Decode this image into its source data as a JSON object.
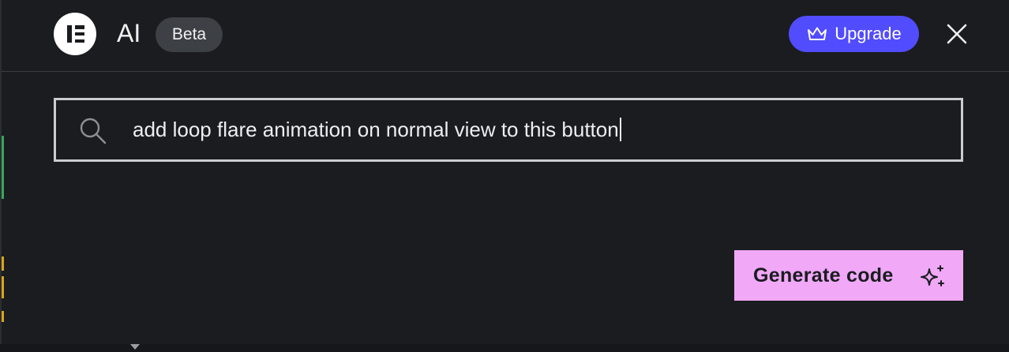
{
  "header": {
    "title": "AI",
    "badge": "Beta",
    "upgrade_label": "Upgrade",
    "logo_icon": "elementor-logo-icon",
    "upgrade_icon": "crown-icon",
    "close_icon": "close-icon"
  },
  "prompt": {
    "value": "add loop flare animation on normal view to this button",
    "icon": "search-icon"
  },
  "actions": {
    "generate_label": "Generate code",
    "generate_icon": "sparkle-icon"
  },
  "colors": {
    "background": "#1a1c1f",
    "upgrade_accent": "#524cff",
    "generate_accent": "#f0a8f7",
    "badge_bg": "#3d4045"
  }
}
